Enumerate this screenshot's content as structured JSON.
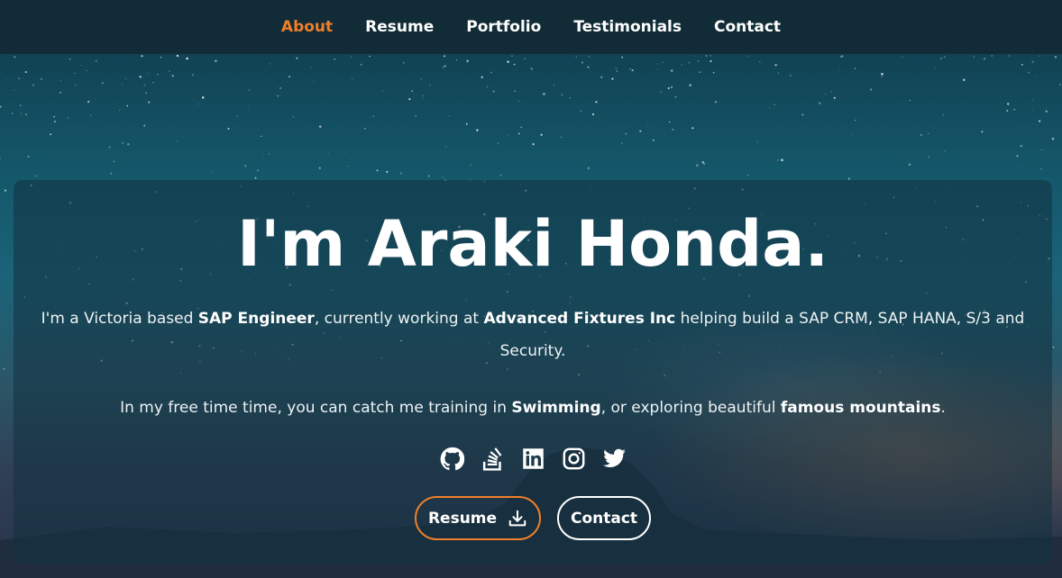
{
  "nav": {
    "items": [
      {
        "label": "About",
        "active": true
      },
      {
        "label": "Resume",
        "active": false
      },
      {
        "label": "Portfolio",
        "active": false
      },
      {
        "label": "Testimonials",
        "active": false
      },
      {
        "label": "Contact",
        "active": false
      }
    ]
  },
  "hero": {
    "title": "I'm Araki Honda.",
    "p1": {
      "t1": "I'm a Victoria based ",
      "b1": "SAP Engineer",
      "t2": ", currently working at ",
      "b2": "Advanced Fixtures Inc",
      "t3": " helping build a SAP CRM, SAP HANA, S/3 and Security."
    },
    "p2": {
      "t1": "In my free time time, you can catch me training in ",
      "b1": "Swimming",
      "t2": ", or exploring beautiful ",
      "b2": "famous mountains",
      "t3": "."
    },
    "socials": [
      "github-icon",
      "stackoverflow-icon",
      "linkedin-icon",
      "instagram-icon",
      "twitter-icon"
    ],
    "buttons": {
      "resume_label": "Resume",
      "contact_label": "Contact"
    }
  },
  "colors": {
    "accent": "#f07f2a",
    "navbar": "#112c36"
  }
}
